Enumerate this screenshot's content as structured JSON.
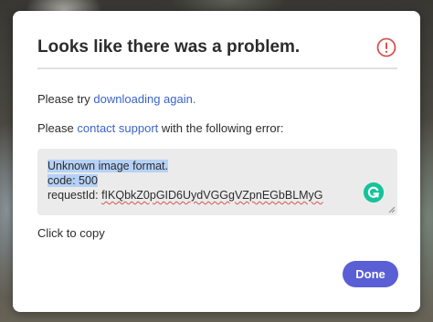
{
  "dialog": {
    "title": "Looks like there was a problem.",
    "alert_icon": "alert-circle-icon",
    "line1_prefix": "Please try ",
    "line1_link": "downloading again.",
    "line2_prefix": "Please ",
    "line2_link": "contact support",
    "line2_suffix": " with the following error:",
    "error": {
      "line1": "Unknown image format.",
      "line2": "code: 500",
      "line3_label": "requestId: ",
      "line3_value": "fIKQbkZ0pGID6UydVGGgVZpnEGbBLMyG"
    },
    "grammarly_icon": "grammarly-g-icon",
    "click_to_copy": "Click to copy",
    "done_label": "Done"
  },
  "colors": {
    "accent": "#5a5fd6",
    "link": "#3b63c9",
    "alert": "#d9534f",
    "grammarly": "#15c39a"
  }
}
